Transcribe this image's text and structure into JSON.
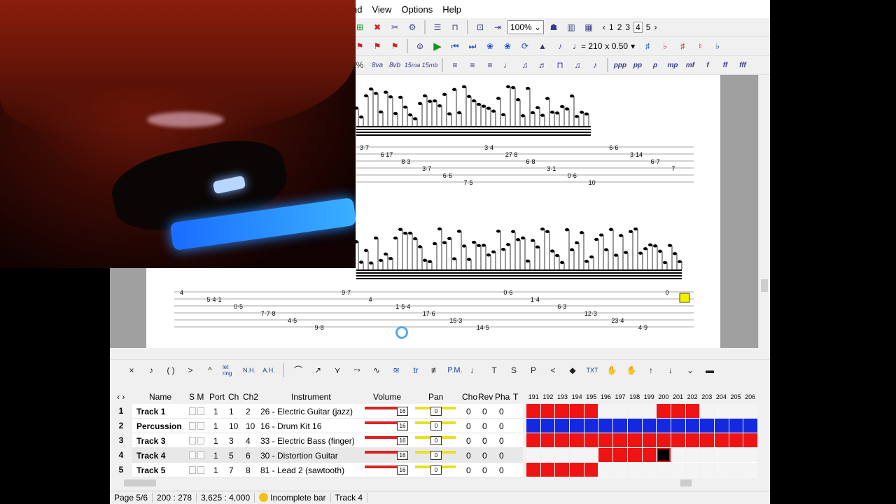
{
  "menu": [
    "nd",
    "View",
    "Options",
    "Help"
  ],
  "toolbar": {
    "zoom": "100%",
    "pages": [
      "1",
      "2",
      "3",
      "4",
      "5"
    ],
    "current_page": "4",
    "tempo": "♩= 210",
    "speed": "x 0.50",
    "ottava": [
      "8va",
      "8vb",
      "15ma",
      "15mb"
    ],
    "dynamics": [
      "ppp",
      "pp",
      "p",
      "mp",
      "mf",
      "f",
      "ff",
      "fff"
    ],
    "percent_partial": "%"
  },
  "effects_toolbar": [
    "×",
    "♪",
    "( )",
    ">",
    "^",
    "let ring",
    "N.H.",
    "A.H.",
    "P.M.",
    "T",
    "S",
    "P",
    "<",
    "TXT"
  ],
  "tracks_header": {
    "name": "Name",
    "sm": "S M",
    "port": "Port",
    "ch": "Ch",
    "ch2": "Ch2",
    "instrument": "Instrument",
    "volume": "Volume",
    "pan": "Pan",
    "cho": "Cho",
    "rev": "Rev",
    "pha": "Pha",
    "t": "T"
  },
  "tracks": [
    {
      "num": "1",
      "name": "Track 1",
      "port": "1",
      "ch": "1",
      "ch2": "2",
      "instrument": "26 - Electric Guitar (jazz)",
      "vol": "16",
      "pan": "0",
      "cho": "0",
      "rev": "0",
      "pha": "0"
    },
    {
      "num": "2",
      "name": "Percussion",
      "port": "1",
      "ch": "10",
      "ch2": "10",
      "instrument": "16 - Drum Kit 16",
      "vol": "16",
      "pan": "0",
      "cho": "0",
      "rev": "0",
      "pha": "0"
    },
    {
      "num": "3",
      "name": "Track 3",
      "port": "1",
      "ch": "3",
      "ch2": "4",
      "instrument": "33 - Electric Bass (finger)",
      "vol": "16",
      "pan": "0",
      "cho": "0",
      "rev": "0",
      "pha": "0"
    },
    {
      "num": "4",
      "name": "Track 4",
      "port": "1",
      "ch": "5",
      "ch2": "6",
      "instrument": "30 - Distortion Guitar",
      "vol": "16",
      "pan": "0",
      "cho": "0",
      "rev": "0",
      "pha": "0"
    },
    {
      "num": "5",
      "name": "Track 5",
      "port": "1",
      "ch": "7",
      "ch2": "8",
      "instrument": "81 - Lead 2 (sawtooth)",
      "vol": "16",
      "pan": "0",
      "cho": "0",
      "rev": "0",
      "pha": "0"
    }
  ],
  "measures": [
    "191",
    "192",
    "193",
    "194",
    "195",
    "196",
    "197",
    "198",
    "199",
    "200",
    "201",
    "202",
    "203",
    "204",
    "205",
    "206"
  ],
  "grid_colors": {
    "filled_guitar": "#ee1414",
    "filled_drums": "#1428e0",
    "empty": "#f4f4f4"
  },
  "grid": [
    [
      "r",
      "r",
      "r",
      "r",
      "r",
      "e",
      "e",
      "e",
      "e",
      "r",
      "r",
      "r",
      "e",
      "e",
      "e",
      "e"
    ],
    [
      "b",
      "b",
      "b",
      "b",
      "b",
      "b",
      "b",
      "b",
      "b",
      "b",
      "b",
      "b",
      "b",
      "b",
      "b",
      "b"
    ],
    [
      "r",
      "r",
      "r",
      "r",
      "r",
      "r",
      "r",
      "r",
      "r",
      "r",
      "r",
      "r",
      "r",
      "r",
      "r",
      "r"
    ],
    [
      "e",
      "e",
      "e",
      "e",
      "e",
      "r",
      "r",
      "r",
      "r",
      "c",
      "e",
      "e",
      "e",
      "e",
      "e",
      "e"
    ],
    [
      "r",
      "r",
      "r",
      "r",
      "r",
      "e",
      "e",
      "e",
      "e",
      "e",
      "e",
      "e",
      "e",
      "e",
      "e",
      "e"
    ]
  ],
  "tab_line1": [
    "3·7",
    "6 17",
    "8·3",
    "3·7",
    "6·6",
    "7·5",
    "3·4",
    "27 8",
    "6·8",
    "3·1",
    "0·6",
    "10",
    "6·6",
    "3·14",
    "6·7",
    "7"
  ],
  "tab_line2": [
    "4",
    "5·4·1",
    "0·5",
    "7·7·8",
    "4·5",
    "9·8",
    "9·7",
    "4",
    "1·5·4",
    "17·6",
    "15·3",
    "14·5",
    "0·6",
    "1·4",
    "6·3",
    "12·3",
    "23·4",
    "4·9",
    "0"
  ],
  "status": {
    "page": "Page 5/6",
    "bar": "200 : 278",
    "position": "3,625 : 4,000",
    "warning": "Incomplete bar",
    "track": "Track 4"
  }
}
